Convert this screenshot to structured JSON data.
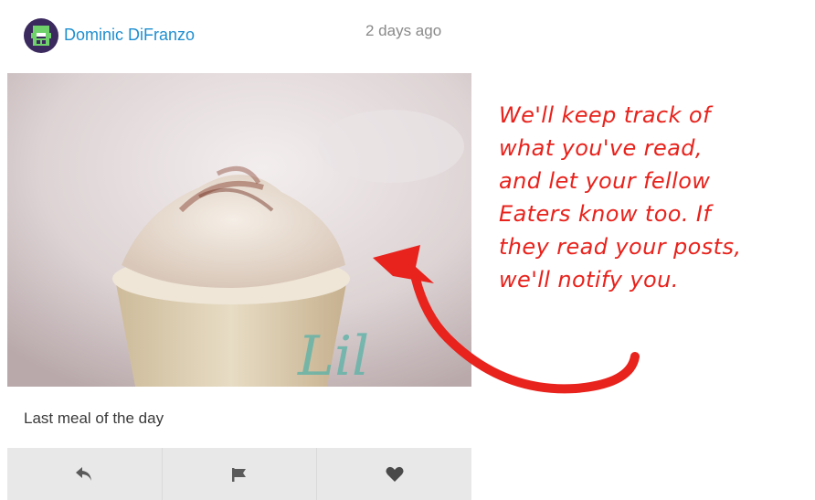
{
  "post": {
    "author": "Dominic DiFranzo",
    "timestamp": "2 days ago",
    "caption": "Last meal of the day",
    "image_alt": "Latte with whipped cream and cocoa dust"
  },
  "actions": [
    {
      "icon": "reply-icon"
    },
    {
      "icon": "flag-icon"
    },
    {
      "icon": "heart-icon"
    }
  ],
  "annotation": {
    "lines": [
      "We'll keep track of",
      "what you've read,",
      "and let your fellow",
      "Eaters know too. If",
      "they read your posts,",
      "we'll notify you."
    ],
    "color": "#e8221c"
  },
  "colors": {
    "author_link": "#1f8fd0",
    "action_bar": "#e8e8e8"
  }
}
